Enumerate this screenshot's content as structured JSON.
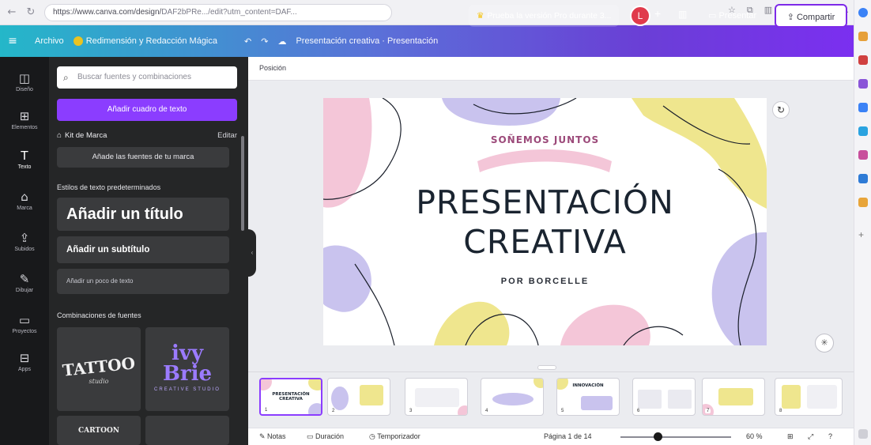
{
  "browser": {
    "url_prefix": "https://www.canva.com/design/",
    "url_rest": "DAF2bPRe.../edit?utm_content=DAF...",
    "icons": [
      "star-icon",
      "extensions-icon",
      "profile-icon"
    ]
  },
  "topbar": {
    "menu_label": "Archivo",
    "resize_label": "Redimensión y Redacción Mágica",
    "doc_title": "Presentación creativa · Presentación",
    "trial_label": "Prueba la versión Pro durante 3...",
    "avatar_initial": "L",
    "present_label": "Presentar",
    "share_label": "Compartir"
  },
  "rail": {
    "items": [
      {
        "label": "Diseño",
        "icon": "◫"
      },
      {
        "label": "Elementos",
        "icon": "⊞"
      },
      {
        "label": "Texto",
        "icon": "T"
      },
      {
        "label": "Marca",
        "icon": "⌂"
      },
      {
        "label": "Subidos",
        "icon": "⇪"
      },
      {
        "label": "Dibujar",
        "icon": "✎"
      },
      {
        "label": "Proyectos",
        "icon": "▭"
      },
      {
        "label": "Apps",
        "icon": "⊟"
      }
    ]
  },
  "panel": {
    "search_placeholder": "Buscar fuentes y combinaciones",
    "add_textbox": "Añadir cuadro de texto",
    "brand_kit": "Kit de Marca",
    "edit": "Editar",
    "add_brand_fonts": "Añade las fuentes de tu marca",
    "default_styles": "Estilos de texto predeterminados",
    "add_title": "Añadir un título",
    "add_subtitle": "Añadir un subtítulo",
    "add_body": "Añadir un poco de texto",
    "font_combos": "Combinaciones de fuentes",
    "combo1": "TATTOO",
    "combo1_sub": "studio",
    "combo2": "ivy\nBrie",
    "combo2_sub": "CREATIVE STUDIO",
    "combo3": "CARTOON"
  },
  "workspace": {
    "header_label": "Posición"
  },
  "slide": {
    "tagline": "SOÑEMOS JUNTOS",
    "title_line1": "PRESENTACIÓN",
    "title_line2": "CREATIVA",
    "byline": "POR BORCELLE"
  },
  "thumbnails": [
    {
      "n": "1",
      "title": "PRESENTACIÓN CREATIVA"
    },
    {
      "n": "2",
      "title": ""
    },
    {
      "n": "3",
      "title": ""
    },
    {
      "n": "4",
      "title": ""
    },
    {
      "n": "5",
      "title": "INNOVACIÓN"
    },
    {
      "n": "6",
      "title": ""
    },
    {
      "n": "7",
      "title": ""
    },
    {
      "n": "8",
      "title": ""
    }
  ],
  "bottombar": {
    "notes": "Notas",
    "duration": "Duración",
    "timer": "Temporizador",
    "page": "Página 1 de 14",
    "zoom": "60 %",
    "zoom_level_pct": 60
  },
  "colors": {
    "accent": "#8b3dff",
    "rail_bg": "#18191b",
    "panel_bg": "#252627",
    "pink": "#f4c6d8",
    "lavender": "#c9c3ee",
    "yellow": "#efe68e"
  }
}
